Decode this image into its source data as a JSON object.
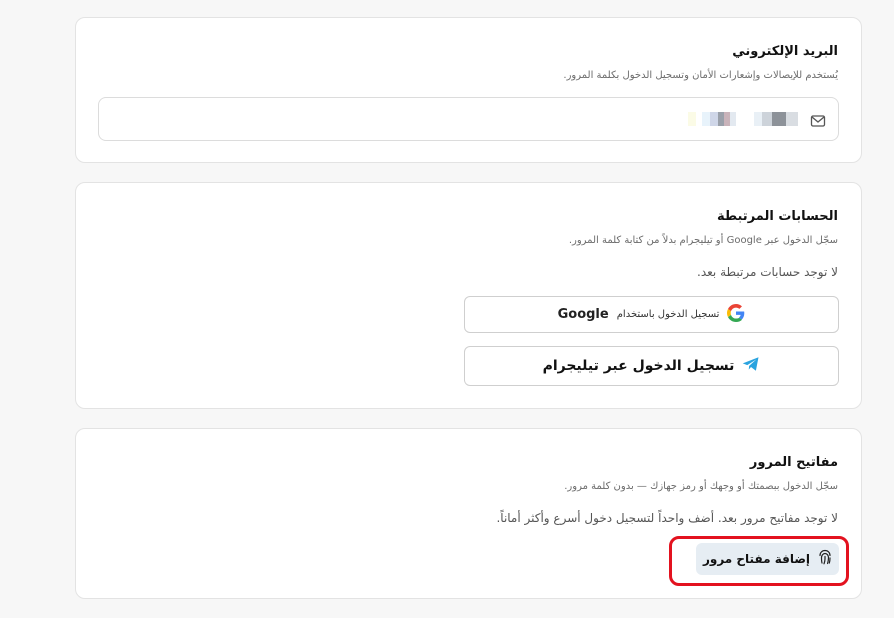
{
  "email_section": {
    "title": "البريد الإلكتروني",
    "description": "يُستخدم للإيصالات وإشعارات الأمان وتسجيل الدخول بكلمة المرور.",
    "email_value": "",
    "icon": "mail-icon"
  },
  "linked_section": {
    "title": "الحسابات المرتبطة",
    "description": "سجّل الدخول عبر Google أو تيليجرام بدلاً من كتابة كلمة المرور.",
    "empty_text": "لا توجد حسابات مرتبطة بعد.",
    "google_button": {
      "label_arabic": "تسجيل الدخول باستخدام",
      "label_brand": "Google",
      "icon": "google-icon"
    },
    "telegram_button": {
      "label": "تسجيل الدخول عبر تيليجرام",
      "icon": "telegram-icon"
    }
  },
  "passkey_section": {
    "title": "مفاتيح المرور",
    "description": "سجّل الدخول ببصمتك أو وجهك أو رمز جهازك — بدون كلمة مرور.",
    "empty_text": "لا توجد مفاتيح مرور بعد. أضف واحداً لتسجيل دخول أسرع وأكثر أماناً.",
    "add_button": {
      "label": "إضافة مفتاح مرور",
      "icon": "fingerprint-icon"
    }
  },
  "colors": {
    "highlight": "#e3121f",
    "passkey_button_bg": "#e6edf3",
    "telegram_blue": "#2aa3df"
  }
}
